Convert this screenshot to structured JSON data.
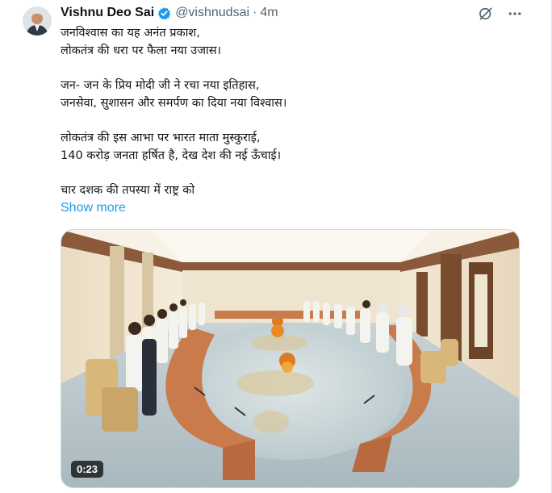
{
  "tweet": {
    "author_name": "Vishnu Deo Sai",
    "handle": "@vishnudsai",
    "separator": "·",
    "time": "4m",
    "paragraphs": [
      [
        "जनविश्वास का यह अनंत प्रकाश,",
        "लोकतंत्र की धरा पर फैला नया उजास।"
      ],
      [
        "जन- जन के प्रिय मोदी जी ने रचा नया इतिहास,",
        "जनसेवा, सुशासन और समर्पण का दिया नया विश्वास।"
      ],
      [
        "लोकतंत्र की इस आभा पर भारत माता मुस्कुराई,",
        "140 करोड़ जनता हर्षित है, देख देश की नई ऊँचाई।"
      ],
      [
        "चार दशक की तपस्या में राष्ट्र को"
      ]
    ],
    "show_more": "Show more",
    "video_duration": "0:23"
  },
  "icons": {
    "verified": "verified-badge-icon",
    "grok": "grok-icon",
    "more": "more-dots-icon"
  },
  "colors": {
    "link": "#1d9bf0",
    "verified": "#1d9bf0",
    "secondary_text": "#536471"
  }
}
